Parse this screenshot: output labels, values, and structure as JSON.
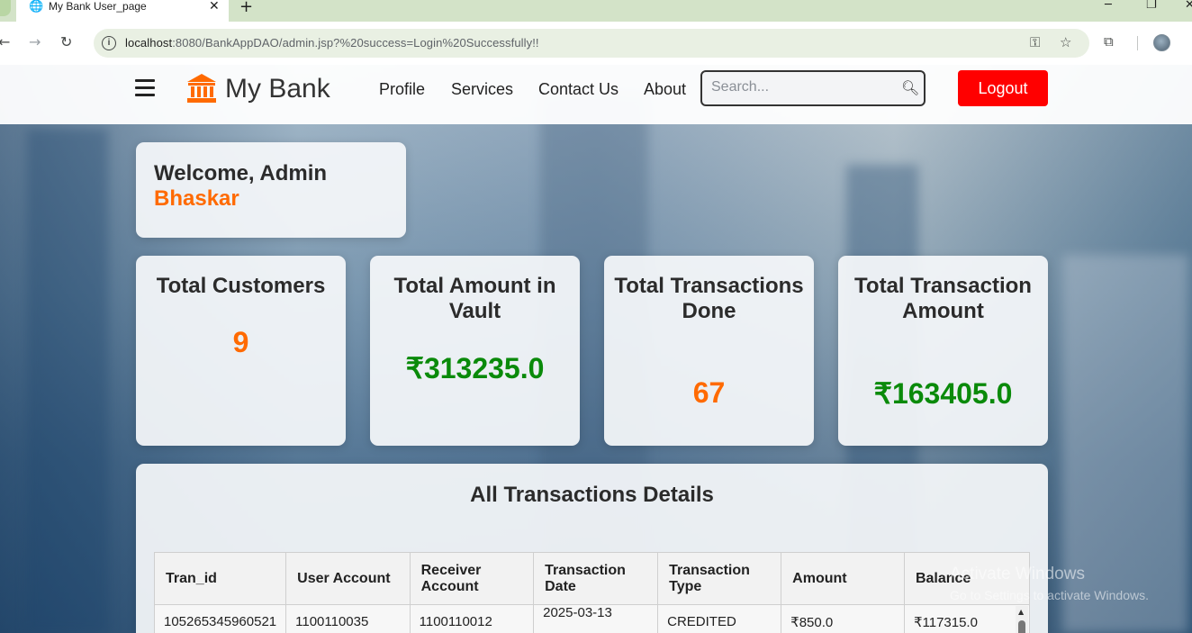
{
  "browser": {
    "tab_title": "My Bank User_page",
    "url_host": "localhost",
    "url_rest": ":8080/BankAppDAO/admin.jsp?%20success=Login%20Successfully!!"
  },
  "navbar": {
    "brand": "My Bank",
    "links": [
      "Profile",
      "Services",
      "Contact Us",
      "About"
    ],
    "search_placeholder": "Search...",
    "logout_label": "Logout"
  },
  "welcome": {
    "line": "Welcome, Admin",
    "name": "Bhaskar"
  },
  "stats": [
    {
      "title": "Total Customers",
      "value": "9",
      "color": "#ff6a00"
    },
    {
      "title": "Total Amount in Vault",
      "value": "₹313235.0",
      "color": "#0a8a0a"
    },
    {
      "title": "Total Transactions Done",
      "value": "67",
      "color": "#ff6a00"
    },
    {
      "title": "Total Transaction Amount",
      "value": "₹163405.0",
      "color": "#0a8a0a"
    }
  ],
  "transactions": {
    "title": "All Transactions Details",
    "headers": [
      "Tran_id",
      "User Account",
      "Receiver Account",
      "Transaction Date",
      "Transaction Type",
      "Amount",
      "Balance"
    ],
    "rows": [
      [
        "105265345960521",
        "1100110035",
        "1100110012",
        "2025-03-13",
        "CREDITED",
        "₹850.0",
        "₹117315.0"
      ]
    ]
  },
  "watermark": {
    "line1": "Activate Windows",
    "line2": "Go to Settings to activate Windows."
  },
  "colors": {
    "accent_orange": "#ff6a00",
    "money_green": "#0a8a0a",
    "logout_red": "#ff0000"
  }
}
